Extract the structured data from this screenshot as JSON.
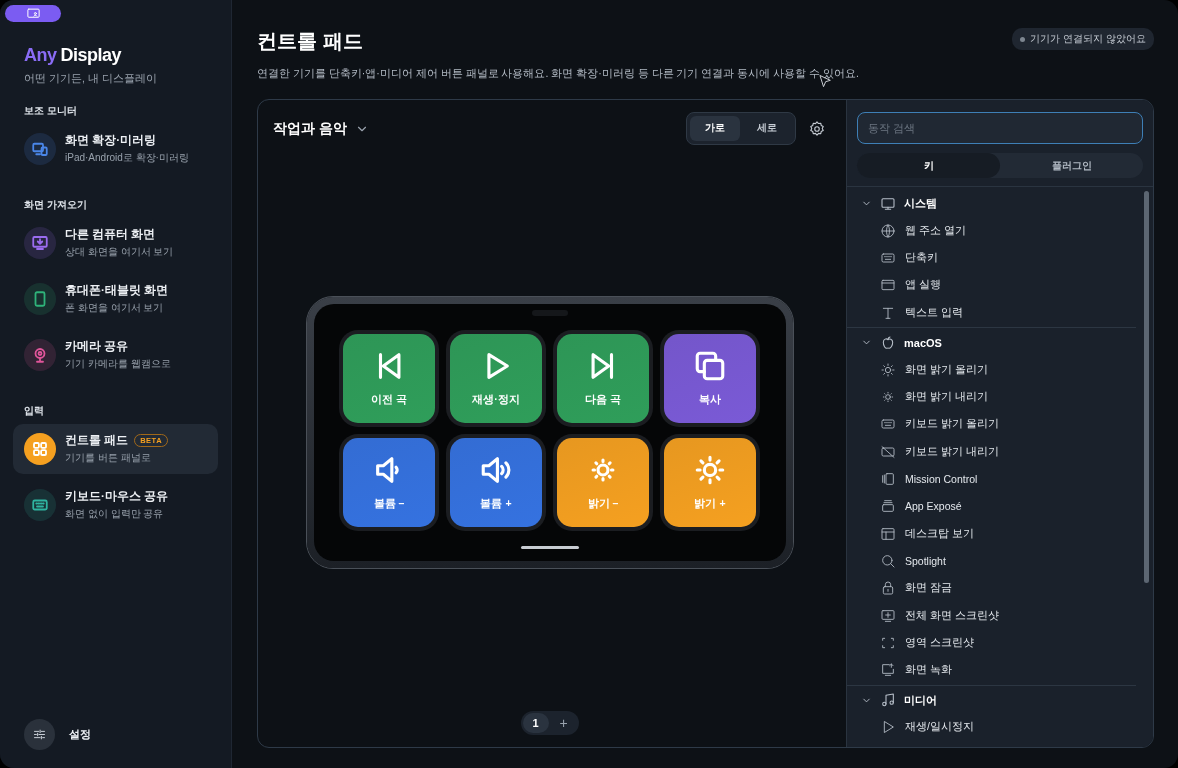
{
  "sidebar": {
    "logo_accent": "Any",
    "logo_rest": "Display",
    "tagline": "어떤 기기든, 내 디스플레이",
    "sections": [
      {
        "title": "보조 모니터",
        "items": [
          {
            "title": "화면 확장·미러링",
            "subtitle": "iPad·Android로 확장·미러링",
            "color": "#4a86e8",
            "selected": false
          }
        ]
      },
      {
        "title": "화면 가져오기",
        "items": [
          {
            "title": "다른 컴퓨터 화면",
            "subtitle": "상대 화면을 여기서 보기",
            "color": "#9b6cf0",
            "selected": false
          },
          {
            "title": "휴대폰·태블릿 화면",
            "subtitle": "폰 화면을 여기서 보기",
            "color": "#2fb37a",
            "selected": false
          },
          {
            "title": "카메라 공유",
            "subtitle": "기기 카메라를 웹캠으로",
            "color": "#e0559a",
            "selected": false
          }
        ]
      },
      {
        "title": "입력",
        "items": [
          {
            "title": "컨트롤 패드",
            "subtitle": "기기를 버튼 패널로",
            "badge": "BETA",
            "color": "#f5a020",
            "selected": true
          },
          {
            "title": "키보드·마우스 공유",
            "subtitle": "화면 없이 입력만 공유",
            "color": "#2fb3a0",
            "selected": false
          }
        ]
      }
    ],
    "settings": "설정"
  },
  "main": {
    "title": "컨트롤 패드",
    "description": "연결한 기기를 단축키·앱·미디어 제어 버튼 패널로 사용해요. 화면 확장·미러링 등 다른 기기 연결과 동시에 사용할 수 있어요.",
    "status": "기기가 연결되지 않았어요"
  },
  "panel": {
    "profile": "작업과 음악",
    "orientation": [
      {
        "label": "가로",
        "selected": true
      },
      {
        "label": "세로",
        "selected": false
      }
    ],
    "keys": [
      {
        "label": "이전 곡",
        "color": "#2f9e5a"
      },
      {
        "label": "재생·정지",
        "color": "#2f9e5a"
      },
      {
        "label": "다음 곡",
        "color": "#2f9e5a"
      },
      {
        "label": "복사",
        "color": "#7a5ad6"
      },
      {
        "label": "볼륨 –",
        "color": "#3572e0"
      },
      {
        "label": "볼륨 +",
        "color": "#3572e0"
      },
      {
        "label": "밝기 –",
        "color": "#f5a020"
      },
      {
        "label": "밝기 +",
        "color": "#f5a020"
      }
    ],
    "pages": [
      {
        "label": "1",
        "selected": true
      }
    ],
    "add_page": "+"
  },
  "actions": {
    "search": {
      "placeholder": "동작 검색"
    },
    "tabs": [
      {
        "label": "키",
        "selected": true
      },
      {
        "label": "플러그인",
        "selected": false
      }
    ],
    "groups": [
      {
        "title": "시스템",
        "expanded": true,
        "items": [
          "웹 주소 열기",
          "단축키",
          "앱 실행",
          "텍스트 입력"
        ]
      },
      {
        "title": "macOS",
        "expanded": true,
        "items": [
          "화면 밝기 올리기",
          "화면 밝기 내리기",
          "키보드 밝기 올리기",
          "키보드 밝기 내리기",
          "Mission Control",
          "App Exposé",
          "데스크탑 보기",
          "Spotlight",
          "화면 잠금",
          "전체 화면 스크린샷",
          "영역 스크린샷",
          "화면 녹화"
        ]
      },
      {
        "title": "미디어",
        "expanded": true,
        "items": [
          "재생/일시정지"
        ]
      }
    ]
  }
}
